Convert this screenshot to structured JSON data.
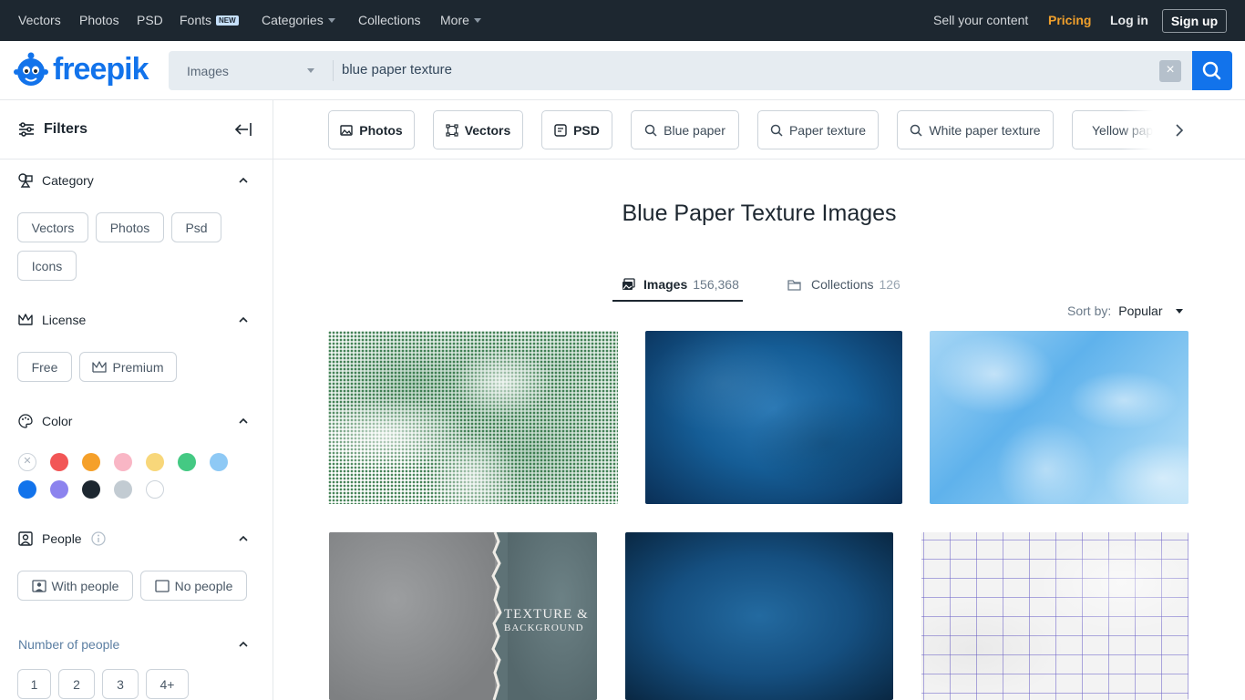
{
  "topnav": {
    "vectors": "Vectors",
    "photos": "Photos",
    "psd": "PSD",
    "fonts": "Fonts",
    "new_badge": "NEW",
    "categories": "Categories",
    "collections": "Collections",
    "more": "More",
    "sell": "Sell your content",
    "pricing": "Pricing",
    "login": "Log in",
    "signup": "Sign up"
  },
  "header": {
    "logo": "freepik",
    "search_type": "Images",
    "search_value": "blue paper texture",
    "clear": "×"
  },
  "filters": {
    "title": "Filters",
    "category": {
      "title": "Category",
      "options": [
        "Vectors",
        "Photos",
        "Psd",
        "Icons"
      ]
    },
    "license": {
      "title": "License",
      "options": [
        "Free",
        "Premium"
      ]
    },
    "color": {
      "title": "Color",
      "swatches": [
        "none",
        "#f25656",
        "#f5a02a",
        "#f9b6c5",
        "#f8d77a",
        "#44c983",
        "#8ec9f5",
        "#1273eb",
        "#8c83ee",
        "#1d2730",
        "#c2cbd2",
        "#ffffff"
      ]
    },
    "people": {
      "title": "People",
      "options": [
        "With people",
        "No people"
      ]
    },
    "number_of_people": {
      "title": "Number of people",
      "options": [
        "1",
        "2",
        "3",
        "4+"
      ]
    }
  },
  "tags": [
    "Photos",
    "Vectors",
    "PSD",
    "Blue paper",
    "Paper texture",
    "White paper texture",
    "Yellow paper"
  ],
  "main": {
    "title": "Blue Paper Texture Images",
    "tabs": [
      {
        "label": "Images",
        "count": "156,368"
      },
      {
        "label": "Collections",
        "count": "126"
      }
    ],
    "sort_label": "Sort by:",
    "sort_value": "Popular",
    "cards": [
      {
        "icon": "halftone-green-texture"
      },
      {
        "icon": "dark-blue-grunge-texture"
      },
      {
        "icon": "light-blue-watercolor-texture"
      },
      {
        "icon": "torn-paper-texture",
        "text1": "TEXTURE &",
        "text2": "BACKGROUND"
      },
      {
        "icon": "blue-vignette-texture"
      },
      {
        "icon": "grid-paper-texture"
      }
    ]
  }
}
